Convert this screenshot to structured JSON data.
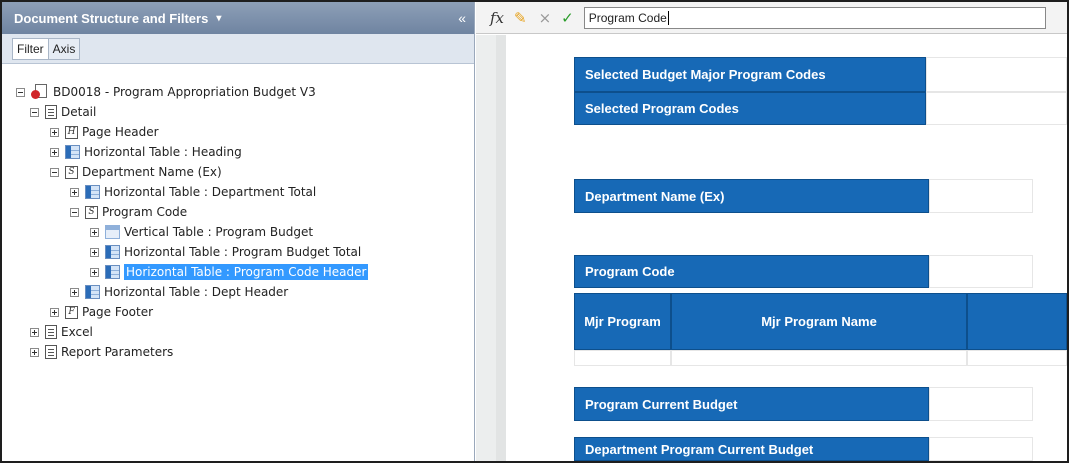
{
  "left_panel": {
    "title": "Document Structure and Filters",
    "title_caret": "▾",
    "collapse": "«",
    "tabs": [
      "Filter",
      "Axis"
    ]
  },
  "tree": [
    {
      "label": "BD0018 - Program Appropriation Budget V3",
      "icon": "report-icon",
      "expander": "minus"
    },
    {
      "label": "Detail",
      "icon": "document-icon",
      "expander": "minus"
    },
    {
      "label": "Page Header",
      "icon": "H",
      "expander": "plus"
    },
    {
      "label": "Horizontal Table : Heading",
      "icon": "horizontal-table-icon",
      "expander": "plus"
    },
    {
      "label": "Department Name (Ex)",
      "icon": "S",
      "expander": "minus"
    },
    {
      "label": "Horizontal Table : Department Total",
      "icon": "horizontal-table-icon",
      "expander": "plus"
    },
    {
      "label": "Program Code",
      "icon": "S",
      "expander": "minus"
    },
    {
      "label": "Vertical Table : Program Budget",
      "icon": "vertical-table-icon",
      "expander": "plus"
    },
    {
      "label": "Horizontal Table : Program Budget Total",
      "icon": "horizontal-table-icon",
      "expander": "plus"
    },
    {
      "label": "Horizontal Table : Program Code Header",
      "icon": "horizontal-table-icon",
      "expander": "plus",
      "selected": true
    },
    {
      "label": "Horizontal Table : Dept Header",
      "icon": "horizontal-table-icon",
      "expander": "plus"
    },
    {
      "label": "Page Footer",
      "icon": "F",
      "expander": "plus"
    },
    {
      "label": "Excel",
      "icon": "document-icon",
      "expander": "plus"
    },
    {
      "label": "Report Parameters",
      "icon": "document-icon",
      "expander": "plus"
    }
  ],
  "formula_bar": {
    "fx": "fx",
    "cancel": "×",
    "accept": "✓",
    "value": "Program Code"
  },
  "report": {
    "selected_major": "Selected Budget Major Program Codes",
    "selected_codes": "Selected Program Codes",
    "dept_name": "Department Name (Ex)",
    "program_code": "Program Code",
    "mjr_program": "Mjr Program",
    "mjr_program_name": "Mjr Program Name",
    "program_current_budget": "Program Current Budget",
    "dept_program_current_budget": "Department Program Current Budget"
  },
  "colors": {
    "header_blue": "#1769b6",
    "panel_header": "#7a8ea9",
    "selection": "#3399ff"
  }
}
